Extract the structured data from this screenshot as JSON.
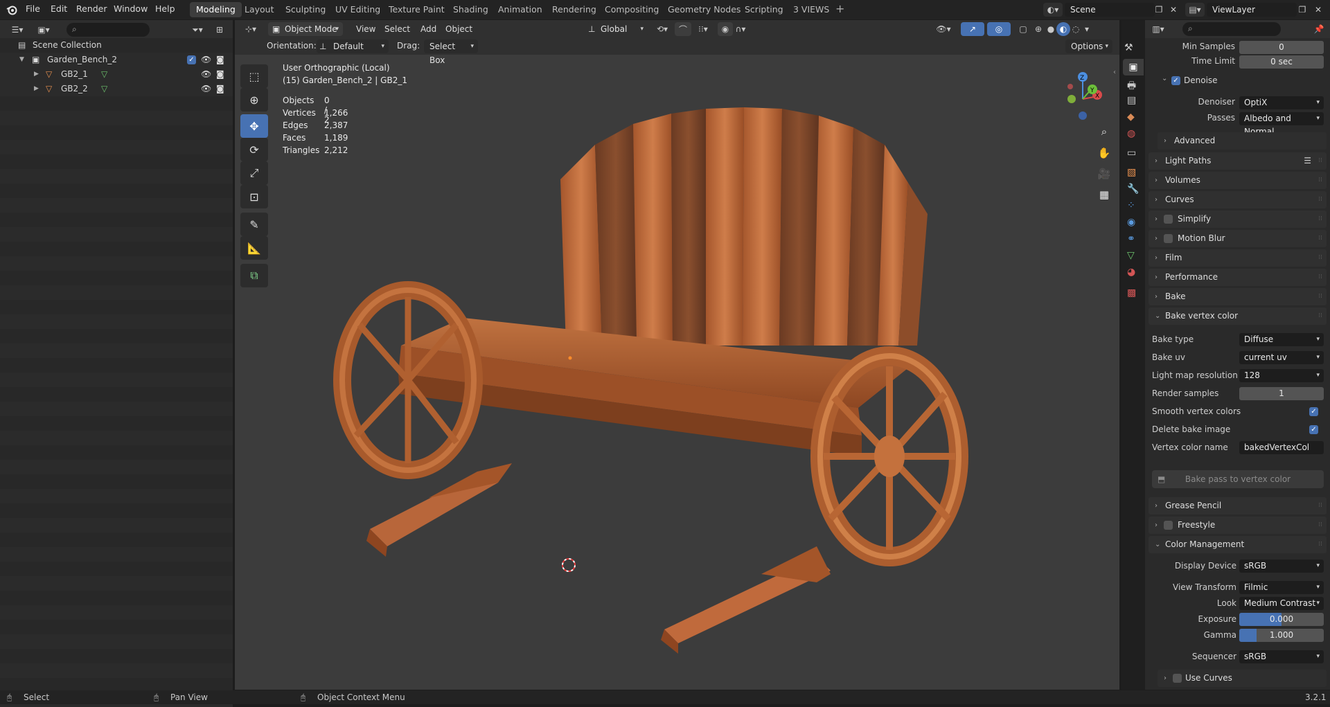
{
  "topbar": {
    "menus": [
      "File",
      "Edit",
      "Render",
      "Window",
      "Help"
    ],
    "workspaces": [
      "Modeling",
      "Layout",
      "Sculpting",
      "UV Editing",
      "Texture Paint",
      "Shading",
      "Animation",
      "Rendering",
      "Compositing",
      "Geometry Nodes",
      "Scripting",
      "3 VIEWS"
    ],
    "active_workspace": "Modeling",
    "scene_name": "Scene",
    "view_layer": "ViewLayer"
  },
  "outliner": {
    "root": "Scene Collection",
    "collection": "Garden_Bench_2",
    "objects": [
      "GB2_1",
      "GB2_2"
    ]
  },
  "viewport_header": {
    "mode": "Object Mode",
    "menus": [
      "View",
      "Select",
      "Add",
      "Object"
    ],
    "transform_orientation": "Global",
    "orientation_label": "Orientation:",
    "orientation_value": "Default",
    "drag_label": "Drag:",
    "drag_value": "Select Box",
    "options_label": "Options"
  },
  "viewport_overlay": {
    "view_name": "User Orthographic (Local)",
    "object_info": "(15) Garden_Bench_2 | GB2_1",
    "stats": [
      {
        "label": "Objects",
        "value": "0 / 2"
      },
      {
        "label": "Vertices",
        "value": "1,266"
      },
      {
        "label": "Edges",
        "value": "2,387"
      },
      {
        "label": "Faces",
        "value": "1,189"
      },
      {
        "label": "Triangles",
        "value": "2,212"
      }
    ],
    "gizmo_axes": {
      "x": "X",
      "y": "Y",
      "z": "Z"
    }
  },
  "properties": {
    "min_samples_label": "Min Samples",
    "min_samples_value": "0",
    "time_limit_label": "Time Limit",
    "time_limit_value": "0 sec",
    "denoise_label": "Denoise",
    "denoiser_label": "Denoiser",
    "denoiser_value": "OptiX",
    "passes_label": "Passes",
    "passes_value": "Albedo and Normal",
    "advanced_label": "Advanced",
    "panels": [
      "Light Paths",
      "Volumes",
      "Curves",
      "Simplify",
      "Motion Blur",
      "Film",
      "Performance",
      "Bake"
    ],
    "bake_vertex_color": {
      "title": "Bake vertex color",
      "bake_type_label": "Bake type",
      "bake_type_value": "Diffuse",
      "bake_uv_label": "Bake uv",
      "bake_uv_value": "current uv",
      "lightmap_label": "Light map resolution",
      "lightmap_value": "128",
      "render_samples_label": "Render samples",
      "render_samples_value": "1",
      "smooth_label": "Smooth vertex colors",
      "delete_label": "Delete bake image",
      "vcol_name_label": "Vertex color name",
      "vcol_name_value": "bakedVertexCol",
      "bake_button": "Bake pass to vertex color"
    },
    "grease_pencil": "Grease Pencil",
    "freestyle": "Freestyle",
    "color_management": {
      "title": "Color Management",
      "display_device_label": "Display Device",
      "display_device_value": "sRGB",
      "view_transform_label": "View Transform",
      "view_transform_value": "Filmic",
      "look_label": "Look",
      "look_value": "Medium Contrast",
      "exposure_label": "Exposure",
      "exposure_value": "0.000",
      "gamma_label": "Gamma",
      "gamma_value": "1.000",
      "sequencer_label": "Sequencer",
      "sequencer_value": "sRGB",
      "use_curves_label": "Use Curves"
    }
  },
  "statusbar": {
    "select": "Select",
    "pan_view": "Pan View",
    "context_menu": "Object Context Menu",
    "version": "3.2.1"
  },
  "colors": {
    "accent": "#4772b3",
    "viewport_bg": "#3c3c3c",
    "wood": "#b4693a"
  }
}
